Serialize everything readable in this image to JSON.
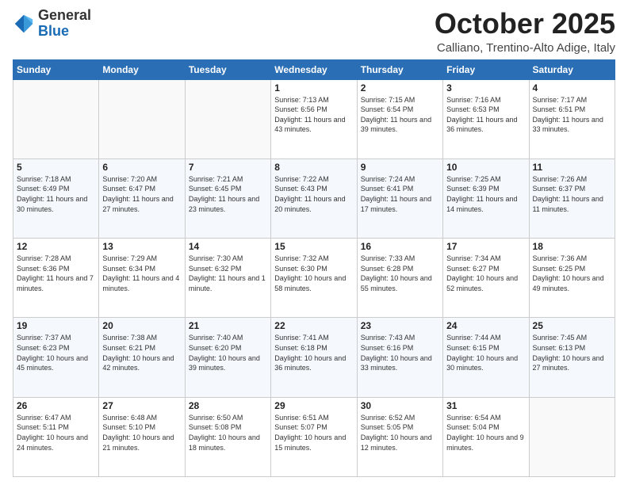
{
  "header": {
    "logo_general": "General",
    "logo_blue": "Blue",
    "month_title": "October 2025",
    "location": "Calliano, Trentino-Alto Adige, Italy"
  },
  "days_of_week": [
    "Sunday",
    "Monday",
    "Tuesday",
    "Wednesday",
    "Thursday",
    "Friday",
    "Saturday"
  ],
  "weeks": [
    [
      {
        "day": "",
        "info": ""
      },
      {
        "day": "",
        "info": ""
      },
      {
        "day": "",
        "info": ""
      },
      {
        "day": "1",
        "info": "Sunrise: 7:13 AM\nSunset: 6:56 PM\nDaylight: 11 hours\nand 43 minutes."
      },
      {
        "day": "2",
        "info": "Sunrise: 7:15 AM\nSunset: 6:54 PM\nDaylight: 11 hours\nand 39 minutes."
      },
      {
        "day": "3",
        "info": "Sunrise: 7:16 AM\nSunset: 6:53 PM\nDaylight: 11 hours\nand 36 minutes."
      },
      {
        "day": "4",
        "info": "Sunrise: 7:17 AM\nSunset: 6:51 PM\nDaylight: 11 hours\nand 33 minutes."
      }
    ],
    [
      {
        "day": "5",
        "info": "Sunrise: 7:18 AM\nSunset: 6:49 PM\nDaylight: 11 hours\nand 30 minutes."
      },
      {
        "day": "6",
        "info": "Sunrise: 7:20 AM\nSunset: 6:47 PM\nDaylight: 11 hours\nand 27 minutes."
      },
      {
        "day": "7",
        "info": "Sunrise: 7:21 AM\nSunset: 6:45 PM\nDaylight: 11 hours\nand 23 minutes."
      },
      {
        "day": "8",
        "info": "Sunrise: 7:22 AM\nSunset: 6:43 PM\nDaylight: 11 hours\nand 20 minutes."
      },
      {
        "day": "9",
        "info": "Sunrise: 7:24 AM\nSunset: 6:41 PM\nDaylight: 11 hours\nand 17 minutes."
      },
      {
        "day": "10",
        "info": "Sunrise: 7:25 AM\nSunset: 6:39 PM\nDaylight: 11 hours\nand 14 minutes."
      },
      {
        "day": "11",
        "info": "Sunrise: 7:26 AM\nSunset: 6:37 PM\nDaylight: 11 hours\nand 11 minutes."
      }
    ],
    [
      {
        "day": "12",
        "info": "Sunrise: 7:28 AM\nSunset: 6:36 PM\nDaylight: 11 hours\nand 7 minutes."
      },
      {
        "day": "13",
        "info": "Sunrise: 7:29 AM\nSunset: 6:34 PM\nDaylight: 11 hours\nand 4 minutes."
      },
      {
        "day": "14",
        "info": "Sunrise: 7:30 AM\nSunset: 6:32 PM\nDaylight: 11 hours\nand 1 minute."
      },
      {
        "day": "15",
        "info": "Sunrise: 7:32 AM\nSunset: 6:30 PM\nDaylight: 10 hours\nand 58 minutes."
      },
      {
        "day": "16",
        "info": "Sunrise: 7:33 AM\nSunset: 6:28 PM\nDaylight: 10 hours\nand 55 minutes."
      },
      {
        "day": "17",
        "info": "Sunrise: 7:34 AM\nSunset: 6:27 PM\nDaylight: 10 hours\nand 52 minutes."
      },
      {
        "day": "18",
        "info": "Sunrise: 7:36 AM\nSunset: 6:25 PM\nDaylight: 10 hours\nand 49 minutes."
      }
    ],
    [
      {
        "day": "19",
        "info": "Sunrise: 7:37 AM\nSunset: 6:23 PM\nDaylight: 10 hours\nand 45 minutes."
      },
      {
        "day": "20",
        "info": "Sunrise: 7:38 AM\nSunset: 6:21 PM\nDaylight: 10 hours\nand 42 minutes."
      },
      {
        "day": "21",
        "info": "Sunrise: 7:40 AM\nSunset: 6:20 PM\nDaylight: 10 hours\nand 39 minutes."
      },
      {
        "day": "22",
        "info": "Sunrise: 7:41 AM\nSunset: 6:18 PM\nDaylight: 10 hours\nand 36 minutes."
      },
      {
        "day": "23",
        "info": "Sunrise: 7:43 AM\nSunset: 6:16 PM\nDaylight: 10 hours\nand 33 minutes."
      },
      {
        "day": "24",
        "info": "Sunrise: 7:44 AM\nSunset: 6:15 PM\nDaylight: 10 hours\nand 30 minutes."
      },
      {
        "day": "25",
        "info": "Sunrise: 7:45 AM\nSunset: 6:13 PM\nDaylight: 10 hours\nand 27 minutes."
      }
    ],
    [
      {
        "day": "26",
        "info": "Sunrise: 6:47 AM\nSunset: 5:11 PM\nDaylight: 10 hours\nand 24 minutes."
      },
      {
        "day": "27",
        "info": "Sunrise: 6:48 AM\nSunset: 5:10 PM\nDaylight: 10 hours\nand 21 minutes."
      },
      {
        "day": "28",
        "info": "Sunrise: 6:50 AM\nSunset: 5:08 PM\nDaylight: 10 hours\nand 18 minutes."
      },
      {
        "day": "29",
        "info": "Sunrise: 6:51 AM\nSunset: 5:07 PM\nDaylight: 10 hours\nand 15 minutes."
      },
      {
        "day": "30",
        "info": "Sunrise: 6:52 AM\nSunset: 5:05 PM\nDaylight: 10 hours\nand 12 minutes."
      },
      {
        "day": "31",
        "info": "Sunrise: 6:54 AM\nSunset: 5:04 PM\nDaylight: 10 hours\nand 9 minutes."
      },
      {
        "day": "",
        "info": ""
      }
    ]
  ]
}
